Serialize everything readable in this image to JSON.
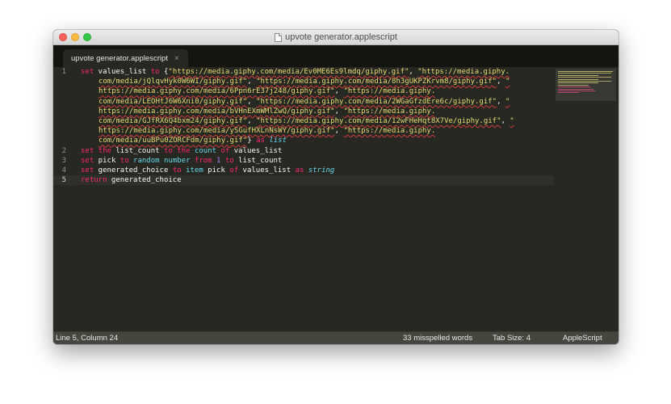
{
  "window": {
    "title": "upvote generator.applescript"
  },
  "tab": {
    "label": "upvote generator.applescript",
    "close_glyph": "×"
  },
  "editor": {
    "line_numbers": [
      "1",
      "2",
      "3",
      "4",
      "5"
    ],
    "current_line": 5,
    "lines": [
      [
        [
          {
            "t": "set",
            "c": "kw"
          },
          {
            "t": " values_list ",
            "c": ""
          },
          {
            "t": "to",
            "c": "kw"
          },
          {
            "t": " {",
            "c": ""
          },
          {
            "t": "\"https://media.giphy.com/media/Ev0ME6Es9lmdq/giphy.gif\"",
            "c": "str"
          },
          {
            "t": ", ",
            "c": ""
          },
          {
            "t": "\"https://media.giphy.",
            "c": "str"
          }
        ],
        [
          {
            "t": "com/media/jQlqvHyk0W6WI/giphy.gif\"",
            "c": "str"
          },
          {
            "t": ", ",
            "c": ""
          },
          {
            "t": "\"https://media.giphy.com/media/8h3gUKPZKrvm8/giphy.gif\"",
            "c": "str"
          },
          {
            "t": ", ",
            "c": ""
          },
          {
            "t": "\"",
            "c": "str"
          }
        ],
        [
          {
            "t": "https://media.giphy.com/media/6Ppn6rE37j248/giphy.gif\"",
            "c": "str"
          },
          {
            "t": ", ",
            "c": ""
          },
          {
            "t": "\"https://media.giphy.",
            "c": "str"
          }
        ],
        [
          {
            "t": "com/media/LEOHtJ6W6Xni0/giphy.gif\"",
            "c": "str"
          },
          {
            "t": ", ",
            "c": ""
          },
          {
            "t": "\"https://media.giphy.com/media/2WGaGfzdEre6c/giphy.gif\"",
            "c": "str"
          },
          {
            "t": ", ",
            "c": ""
          },
          {
            "t": "\"",
            "c": "str"
          }
        ],
        [
          {
            "t": "https://media.giphy.com/media/bVHnEXmWMlZwQ/giphy.gif\"",
            "c": "str"
          },
          {
            "t": ", ",
            "c": ""
          },
          {
            "t": "\"https://media.giphy.",
            "c": "str"
          }
        ],
        [
          {
            "t": "com/media/GJfRX6Q4bxm24/giphy.gif\"",
            "c": "str"
          },
          {
            "t": ", ",
            "c": ""
          },
          {
            "t": "\"https://media.giphy.com/media/12wFHeHqt8X7Ve/giphy.gif\"",
            "c": "str"
          },
          {
            "t": ", ",
            "c": ""
          },
          {
            "t": "\"",
            "c": "str"
          }
        ],
        [
          {
            "t": "https://media.giphy.com/media/ySGufHXLnNsWY/giphy.gif\"",
            "c": "str"
          },
          {
            "t": ", ",
            "c": ""
          },
          {
            "t": "\"https://media.giphy.",
            "c": "str"
          }
        ],
        [
          {
            "t": "com/media/uuBPu0ZORCFdm/giphy.gif\"",
            "c": "str"
          },
          {
            "t": "} ",
            "c": ""
          },
          {
            "t": "as",
            "c": "kw"
          },
          {
            "t": " ",
            "c": ""
          },
          {
            "t": "list",
            "c": "typ"
          }
        ]
      ],
      [
        [
          {
            "t": "set",
            "c": "kw"
          },
          {
            "t": " ",
            "c": ""
          },
          {
            "t": "the",
            "c": "kw"
          },
          {
            "t": " list_count ",
            "c": ""
          },
          {
            "t": "to",
            "c": "kw"
          },
          {
            "t": " ",
            "c": ""
          },
          {
            "t": "the",
            "c": "kw"
          },
          {
            "t": " ",
            "c": ""
          },
          {
            "t": "count",
            "c": "fn"
          },
          {
            "t": " ",
            "c": ""
          },
          {
            "t": "of",
            "c": "kw"
          },
          {
            "t": " values_list",
            "c": ""
          }
        ]
      ],
      [
        [
          {
            "t": "set",
            "c": "kw"
          },
          {
            "t": " pick ",
            "c": ""
          },
          {
            "t": "to",
            "c": "kw"
          },
          {
            "t": " ",
            "c": ""
          },
          {
            "t": "random number",
            "c": "fn"
          },
          {
            "t": " ",
            "c": ""
          },
          {
            "t": "from",
            "c": "kw"
          },
          {
            "t": " ",
            "c": ""
          },
          {
            "t": "1",
            "c": "num"
          },
          {
            "t": " ",
            "c": ""
          },
          {
            "t": "to",
            "c": "kw"
          },
          {
            "t": " list_count",
            "c": ""
          }
        ]
      ],
      [
        [
          {
            "t": "set",
            "c": "kw"
          },
          {
            "t": " generated_choice ",
            "c": ""
          },
          {
            "t": "to",
            "c": "kw"
          },
          {
            "t": " ",
            "c": ""
          },
          {
            "t": "item",
            "c": "fn"
          },
          {
            "t": " pick ",
            "c": ""
          },
          {
            "t": "of",
            "c": "kw"
          },
          {
            "t": " values_list ",
            "c": ""
          },
          {
            "t": "as",
            "c": "kw"
          },
          {
            "t": " ",
            "c": ""
          },
          {
            "t": "string",
            "c": "typ"
          }
        ]
      ],
      [
        [
          {
            "t": "return",
            "c": "kw"
          },
          {
            "t": " generated_choice",
            "c": ""
          }
        ]
      ]
    ]
  },
  "statusbar": {
    "position": "Line 5, Column 24",
    "spelling": "33 misspelled words",
    "tab_size": "Tab Size: 4",
    "syntax": "AppleScript"
  },
  "colors": {
    "background": "#272822",
    "keyword": "#f92672",
    "function": "#66d9ef",
    "string": "#e6db74",
    "number": "#ae81ff",
    "text": "#f8f8f2"
  },
  "icons": {
    "close": "close-window-icon",
    "minimize": "minimize-window-icon",
    "zoom": "zoom-window-icon",
    "document": "document-proxy-icon"
  }
}
